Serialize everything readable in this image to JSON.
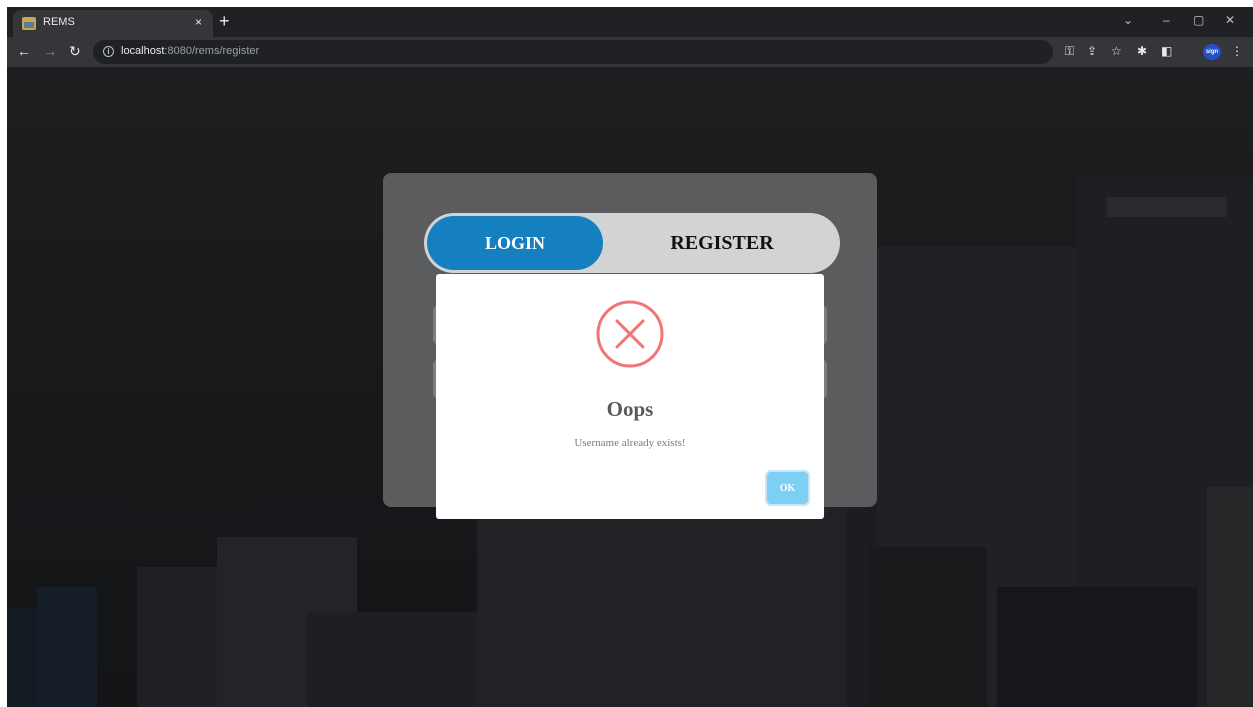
{
  "browser": {
    "tab_title": "REMS",
    "tab_close": "×",
    "new_tab": "+",
    "url_host": "localhost",
    "url_rest": ":8080/rems/register",
    "win_minimize": "–",
    "win_restore": "▢",
    "win_close": "✕",
    "win_dropdown": "⌄",
    "profile_label": "sign"
  },
  "auth": {
    "login_tab": "LOGIN",
    "register_tab": "REGISTER"
  },
  "alert": {
    "title": "Oops",
    "message": "Username already exists!",
    "ok_label": "OK",
    "icon": "error-x-icon",
    "icon_color": "#f27474"
  },
  "colors": {
    "accent": "#1580bf",
    "ok_button": "#7ecff4"
  }
}
